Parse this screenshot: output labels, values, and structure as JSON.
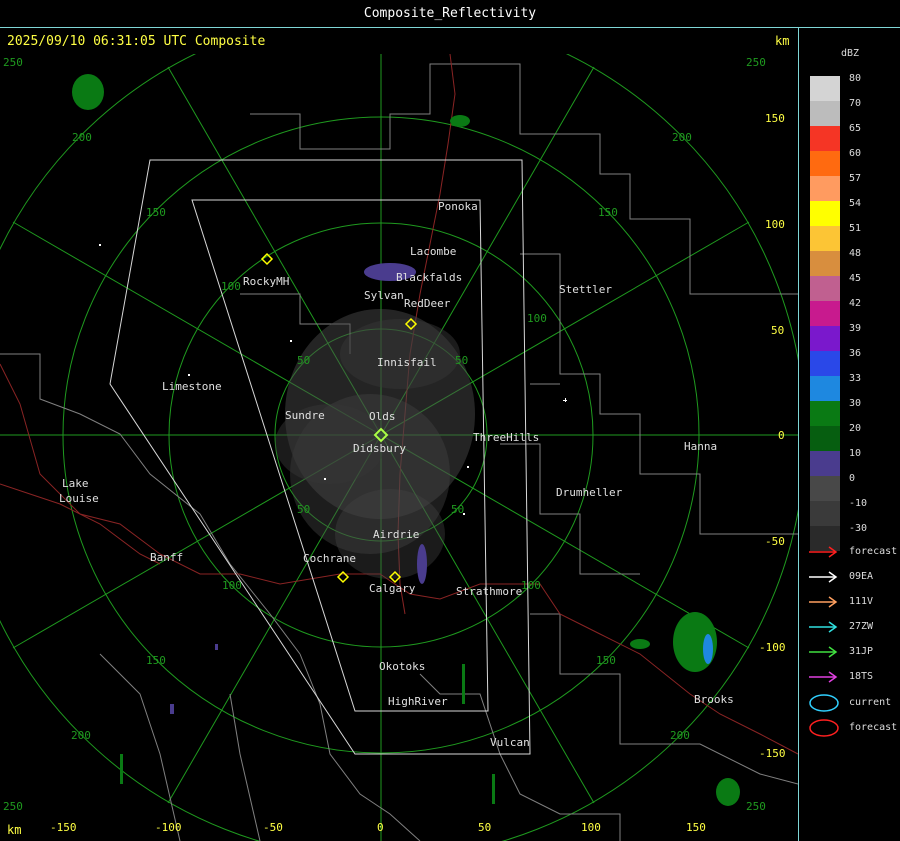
{
  "window": {
    "title": "Composite_Reflectivity"
  },
  "header": {
    "timestamp": "2025/09/10 06:31:05 UTC Composite",
    "km_unit": "km"
  },
  "axes": {
    "x_labels": [
      "-150",
      "-100",
      "-50",
      "0",
      "50",
      "100",
      "150"
    ],
    "y_labels": [
      "150",
      "100",
      "50",
      "0",
      "-50",
      "-100",
      "-150"
    ],
    "corner_labels": [
      "250",
      "250",
      "250",
      "250"
    ],
    "ring_labels": [
      "50",
      "100",
      "150",
      "200",
      "50",
      "100",
      "150",
      "200",
      "50",
      "100",
      "150",
      "200",
      "50",
      "100",
      "150",
      "200"
    ]
  },
  "cities": [
    "Ponoka",
    "Lacombe",
    "Blackfalds",
    "Sylvan",
    "RedDeer",
    "RockyMH",
    "Stettler",
    "Innisfail",
    "Limestone",
    "Sundre",
    "Olds",
    "Didsbury",
    "ThreeHills",
    "Hanna",
    "Lake",
    "Louise",
    "Drumheller",
    "Airdrie",
    "Banff",
    "Cochrane",
    "Calgary",
    "Strathmore",
    "Okotoks",
    "HighRiver",
    "Brooks",
    "Vulcan"
  ],
  "legend": {
    "title": "dBZ",
    "scale": [
      {
        "value": "80",
        "color": "#d4d4d4"
      },
      {
        "value": "70",
        "color": "#bcbcbc"
      },
      {
        "value": "65",
        "color": "#f53525"
      },
      {
        "value": "60",
        "color": "#ff6a10"
      },
      {
        "value": "57",
        "color": "#ff9b60"
      },
      {
        "value": "54",
        "color": "#ffff00"
      },
      {
        "value": "51",
        "color": "#fcc535"
      },
      {
        "value": "48",
        "color": "#d88e3e"
      },
      {
        "value": "45",
        "color": "#c06090"
      },
      {
        "value": "42",
        "color": "#c81a8e"
      },
      {
        "value": "39",
        "color": "#7a18cc"
      },
      {
        "value": "36",
        "color": "#2a48e8"
      },
      {
        "value": "33",
        "color": "#1e88e0"
      },
      {
        "value": "30",
        "color": "#0a7a14"
      },
      {
        "value": "20",
        "color": "#065e10"
      },
      {
        "value": "10",
        "color": "#4a3c8e"
      },
      {
        "value": "0",
        "color": "#484848"
      },
      {
        "value": "-10",
        "color": "#3a3a3a"
      },
      {
        "value": "-30",
        "color": "#2a2a2a"
      }
    ],
    "tracks": [
      {
        "label": "forecast",
        "color": "#ff2020"
      },
      {
        "label": "09EA",
        "color": "#ffffff"
      },
      {
        "label": "111V",
        "color": "#ffa060"
      },
      {
        "label": "27ZW",
        "color": "#30e0e0"
      },
      {
        "label": "31JP",
        "color": "#40e040"
      },
      {
        "label": "18TS",
        "color": "#e040e0"
      }
    ],
    "cells": [
      {
        "label": "current",
        "color": "#30d0ff"
      },
      {
        "label": "forecast",
        "color": "#ff2020"
      }
    ]
  }
}
